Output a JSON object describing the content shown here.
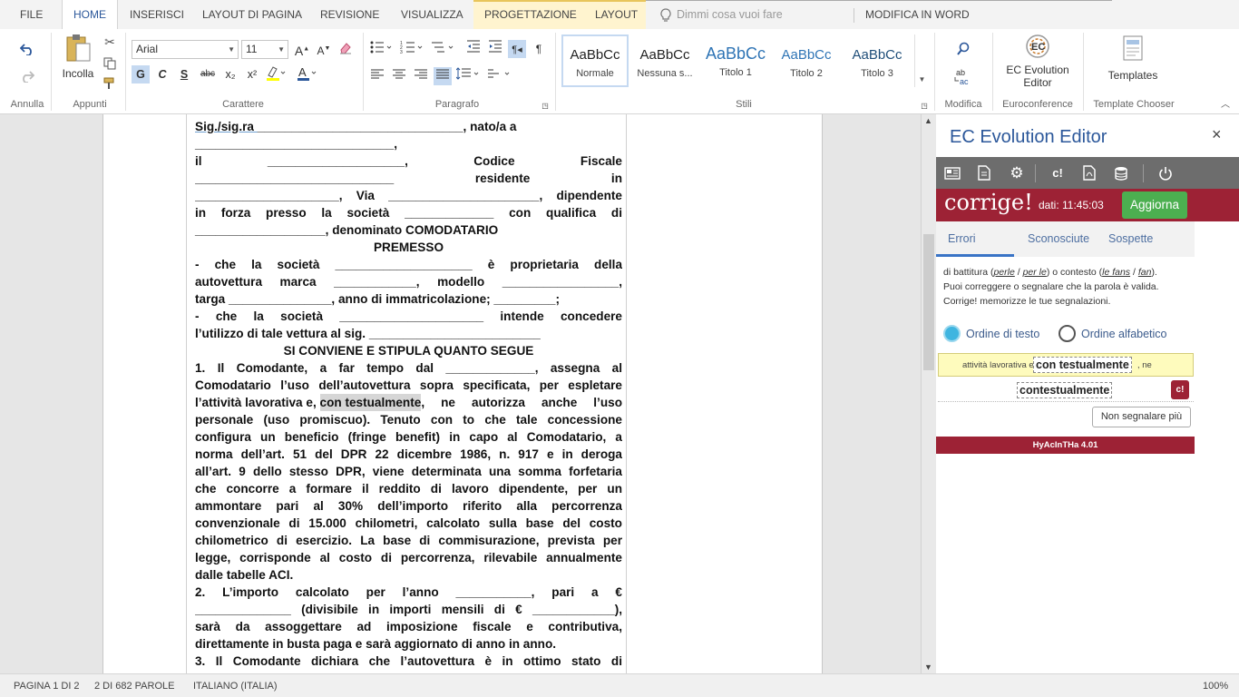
{
  "tabs": {
    "file": "FILE",
    "home": "HOME",
    "insert": "INSERISCI",
    "layout_page": "LAYOUT DI PAGINA",
    "review": "REVISIONE",
    "view": "VISUALIZZA",
    "design": "PROGETTAZIONE",
    "layout": "LAYOUT",
    "tell_me": "Dimmi cosa vuoi fare",
    "edit_in_word": "MODIFICA IN WORD"
  },
  "ribbon": {
    "groups": {
      "undo": "Annulla",
      "clipboard": "Appunti",
      "font": "Carattere",
      "paragraph": "Paragrafo",
      "styles": "Stili",
      "editing": "Modifica",
      "euroconference": "Euroconference",
      "template_chooser": "Template Chooser"
    },
    "paste_label": "Incolla",
    "font_name": "Arial",
    "font_size": "11",
    "bold": "G",
    "italic": "C",
    "underline": "S",
    "strike": "abc",
    "sub": "x₂",
    "sup": "x²",
    "styles": [
      {
        "preview": "AaBbCc",
        "name": "Normale"
      },
      {
        "preview": "AaBbCc",
        "name": "Nessuna s..."
      },
      {
        "preview": "AaBbCc",
        "name": "Titolo 1"
      },
      {
        "preview": "AaBbCc",
        "name": "Titolo 2"
      },
      {
        "preview": "AaBbCc",
        "name": "Titolo 3"
      }
    ],
    "ec_label_1": "EC Evolution",
    "ec_label_2": "Editor",
    "templates_label": "Templates"
  },
  "document": {
    "lines": [
      {
        "pre": "Sig./sig.ra ",
        "mid": "",
        "post": " ______________________________,    nato/a    a"
      },
      {
        "pre": "_____________________________,",
        "mid": "",
        "post": ""
      },
      {
        "pre": "il          ____________________,          Codice          Fiscale",
        "mid": "",
        "post": ""
      },
      {
        "pre": "_____________________________                    residente                   in",
        "mid": "",
        "post": ""
      },
      {
        "pre": "_____________________, Via ______________________, dipendente",
        "mid": "",
        "post": ""
      },
      {
        "pre": "in forza presso la società _____________ con qualifica di",
        "mid": "",
        "post": ""
      },
      {
        "pre": "___________________, denominato COMODATARIO",
        "mid": "",
        "post": ""
      },
      {
        "pre": "PREMESSO",
        "mid": "",
        "post": ""
      },
      {
        "pre": "- che la società ____________________ è proprietaria della",
        "mid": "",
        "post": ""
      },
      {
        "pre": "autovettura marca ____________, modello _________________,",
        "mid": "",
        "post": ""
      },
      {
        "pre": "targa _______________, anno di immatricolazione; _________;",
        "mid": "",
        "post": ""
      },
      {
        "pre": "- che la società _____________________ intende concedere",
        "mid": "",
        "post": ""
      },
      {
        "pre": "l’utilizzo di tale vettura al sig. _________________________",
        "mid": "",
        "post": ""
      },
      {
        "pre": "SI CONVIENE E STIPULA QUANTO SEGUE",
        "mid": "",
        "post": ""
      },
      {
        "pre": "1. Il Comodante, a far tempo dal _____________, assegna al",
        "mid": "",
        "post": ""
      },
      {
        "pre": "Comodatario l’uso dell’autovettura sopra specificata, per espletare",
        "mid": "",
        "post": ""
      },
      {
        "pre": "l’attività lavorativa e, ",
        "mid": "con testualmente",
        "post": ", ne autorizza anche l’uso"
      },
      {
        "pre": "personale (uso promiscuo). Tenuto con to che tale concessione",
        "mid": "",
        "post": ""
      },
      {
        "pre": "configura un beneficio (fringe benefit) in capo al Comodatario, a",
        "mid": "",
        "post": ""
      },
      {
        "pre": "norma dell’art. 51 del DPR 22 dicembre 1986, n. 917 e in deroga",
        "mid": "",
        "post": ""
      },
      {
        "pre": "all’art. 9 dello stesso DPR, viene determinata una somma forfetaria",
        "mid": "",
        "post": ""
      },
      {
        "pre": "che concorre a formare il reddito di lavoro dipendente, per un",
        "mid": "",
        "post": ""
      },
      {
        "pre": "ammontare pari al 30% dell’importo riferito alla percorrenza",
        "mid": "",
        "post": ""
      },
      {
        "pre": "convenzionale di 15.000 chilometri, calcolato sulla base del costo",
        "mid": "",
        "post": ""
      },
      {
        "pre": "chilometrico di esercizio. La base di commisurazione, prevista per",
        "mid": "",
        "post": ""
      },
      {
        "pre": "legge, corrisponde al costo di percorrenza, rilevabile annualmente",
        "mid": "",
        "post": ""
      },
      {
        "pre": "dalle tabelle ACI.",
        "mid": "",
        "post": ""
      },
      {
        "pre": "2. L’importo calcolato per l’anno ___________, pari a €",
        "mid": "",
        "post": ""
      },
      {
        "pre": "______________ (divisibile in importi mensili di € ____________),",
        "mid": "",
        "post": ""
      },
      {
        "pre": "sarà da assoggettare ad imposizione fiscale e contributiva,",
        "mid": "",
        "post": ""
      },
      {
        "pre": "direttamente in busta paga e sarà aggiornato di anno in anno.",
        "mid": "",
        "post": ""
      },
      {
        "pre": "3. Il Comodante dichiara che l’autovettura è in ottimo stato di",
        "mid": "",
        "post": ""
      }
    ]
  },
  "pane": {
    "title": "EC Evolution Editor",
    "close": "×",
    "corrige_logo": "corrige!",
    "date_text": "dati: 11:45:03",
    "refresh": "Aggiorna",
    "subtabs": [
      "Errori",
      "Sconosciute",
      "Sospette"
    ],
    "info_line1_a": "di battitura (",
    "info_line1_b": "perle",
    "info_line1_c": " / ",
    "info_line1_d": "per le",
    "info_line1_e": ") o contesto (",
    "info_line1_f": "le fans",
    "info_line1_g": " / ",
    "info_line1_h": "fan",
    "info_line1_i": ").",
    "info_line2": "Puoi correggere o segnalare che la parola è valida.",
    "info_line3": "Corrige! memorizze le tue segnalazioni.",
    "radio_text": "Ordine di testo",
    "radio_alpha": "Ordine alfabetico",
    "context_before": "attività lavorativa e,",
    "context_word": "con testualmente",
    "context_after": ", ne",
    "suggestion": "contestualmente",
    "suggestion_btn": "c!",
    "dont_flag": "Non segnalare più",
    "footer": "HyAcInTHa 4.01"
  },
  "status": {
    "page": "PAGINA 1 DI 2",
    "words": "2 DI 682 PAROLE",
    "language": "ITALIANO (ITALIA)",
    "zoom": "100%"
  },
  "colors": {
    "accent": "#2b579a",
    "corrige_red": "#9d2235",
    "refresh_green": "#4caf50",
    "radio_selected": "#3fb5e0"
  }
}
